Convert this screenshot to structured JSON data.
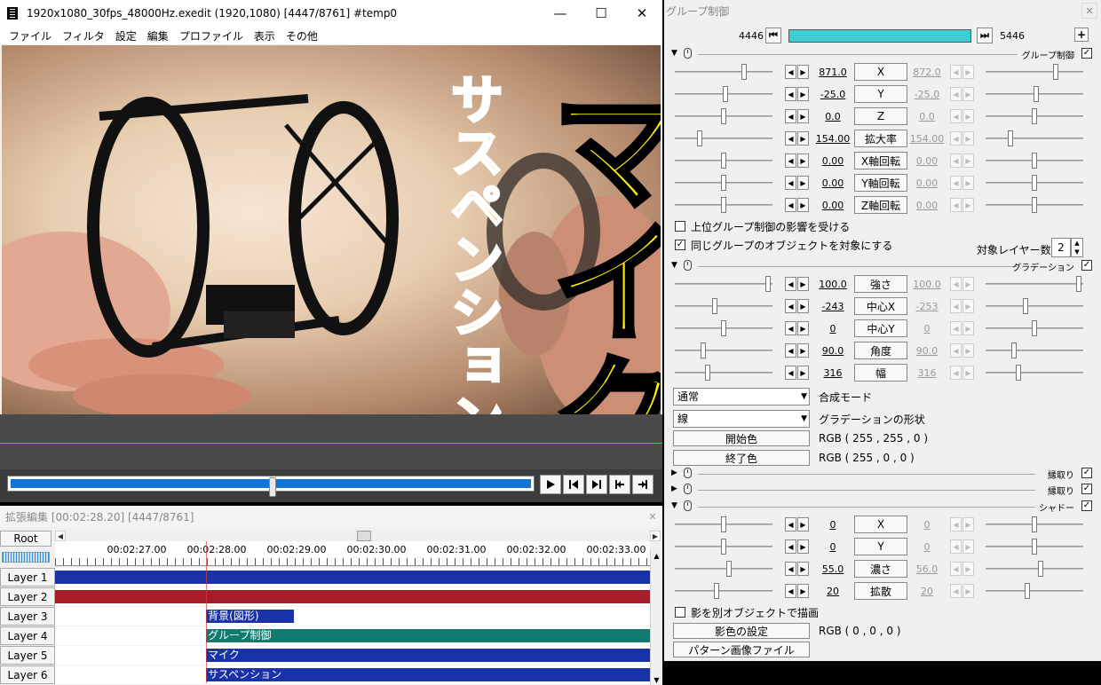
{
  "main": {
    "title": "1920x1080_30fps_48000Hz.exedit (1920,1080)  [4447/8761]  #temp0",
    "window_buttons": [
      "—",
      "☐",
      "✕"
    ],
    "menu": [
      "ファイル",
      "フィルタ",
      "設定",
      "編集",
      "プロファイル",
      "表示",
      "その他"
    ],
    "preview": {
      "text_main": "マイク",
      "text_sub": "サスペンション"
    },
    "seek_progress": 0.5
  },
  "timeline": {
    "title": "拡張編集 [00:02:28.20] [4447/8761]",
    "close": "✕",
    "root_label": "Root",
    "ticks": [
      "00:02:27.00",
      "00:02:28.00",
      "00:02:29.00",
      "00:02:30.00",
      "00:02:31.00",
      "00:02:32.00",
      "00:02:33.00"
    ],
    "layers": [
      {
        "name": "Layer 1",
        "clip_label": "",
        "color": "#1932a8",
        "start": 0.0
      },
      {
        "name": "Layer 2",
        "clip_label": "",
        "color": "#a61c28",
        "start": 0.0
      },
      {
        "name": "Layer 3",
        "clip_label": "背景(図形)",
        "color": "#1932a8",
        "start": 0.254,
        "end": 0.402
      },
      {
        "name": "Layer 4",
        "clip_label": "グループ制御",
        "color": "#0f7a6e",
        "start": 0.254
      },
      {
        "name": "Layer 5",
        "clip_label": "マイク",
        "color": "#1932a8",
        "start": 0.254
      },
      {
        "name": "Layer 6",
        "clip_label": "サスペンション",
        "color": "#1932a8",
        "start": 0.254
      }
    ]
  },
  "gc": {
    "title": "グループ制御",
    "close": "✕",
    "frame_start": "4446",
    "frame_end": "5446",
    "section1_name": "グループ制御",
    "params1": [
      {
        "label": "X",
        "start": "871.0",
        "end": "872.0",
        "pos_l": 0.72,
        "pos_r": 0.73
      },
      {
        "label": "Y",
        "start": "-25.0",
        "end": "-25.0",
        "pos_l": 0.52,
        "pos_r": 0.52
      },
      {
        "label": "Z",
        "start": "0.0",
        "end": "0.0",
        "pos_l": 0.5,
        "pos_r": 0.5
      },
      {
        "label": "拡大率",
        "start": "154.00",
        "end": "154.00",
        "pos_l": 0.24,
        "pos_r": 0.24
      },
      {
        "label": "X軸回転",
        "start": "0.00",
        "end": "0.00",
        "pos_l": 0.5,
        "pos_r": 0.5
      },
      {
        "label": "Y軸回転",
        "start": "0.00",
        "end": "0.00",
        "pos_l": 0.5,
        "pos_r": 0.5
      },
      {
        "label": "Z軸回転",
        "start": "0.00",
        "end": "0.00",
        "pos_l": 0.5,
        "pos_r": 0.5
      }
    ],
    "cb_upper": "上位グループ制御の影響を受ける",
    "cb_same": "同じグループのオブジェクトを対象にする",
    "layer_count_label": "対象レイヤー数",
    "layer_count": "2",
    "section2_name": "グラデーション",
    "params2": [
      {
        "label": "強さ",
        "start": "100.0",
        "end": "100.0",
        "pos_l": 0.98,
        "pos_r": 0.98
      },
      {
        "label": "中心X",
        "start": "-243",
        "end": "-253",
        "pos_l": 0.4,
        "pos_r": 0.4
      },
      {
        "label": "中心Y",
        "start": "0",
        "end": "0",
        "pos_l": 0.5,
        "pos_r": 0.5
      },
      {
        "label": "角度",
        "start": "90.0",
        "end": "90.0",
        "pos_l": 0.28,
        "pos_r": 0.28
      },
      {
        "label": "幅",
        "start": "316",
        "end": "316",
        "pos_l": 0.33,
        "pos_r": 0.33
      }
    ],
    "blend_mode": "通常",
    "blend_mode_label": "合成モード",
    "grad_shape": "線",
    "grad_shape_label": "グラデーションの形状",
    "start_color_btn": "開始色",
    "start_color": "RGB ( 255 , 255 , 0 )",
    "end_color_btn": "終了色",
    "end_color": "RGB ( 255 , 0 , 0 )",
    "section3_name": "縁取り",
    "section4_name": "縁取り",
    "section5_name": "シャドー",
    "params5": [
      {
        "label": "X",
        "start": "0",
        "end": "0",
        "pos_l": 0.5,
        "pos_r": 0.5
      },
      {
        "label": "Y",
        "start": "0",
        "end": "0",
        "pos_l": 0.5,
        "pos_r": 0.5
      },
      {
        "label": "濃さ",
        "start": "55.0",
        "end": "56.0",
        "pos_l": 0.56,
        "pos_r": 0.57
      },
      {
        "label": "拡散",
        "start": "20",
        "end": "20",
        "pos_l": 0.42,
        "pos_r": 0.42
      }
    ],
    "cb_shadow_separate": "影を別オブジェクトで描画",
    "shadow_color_btn": "影色の設定",
    "shadow_color": "RGB ( 0 , 0 , 0 )",
    "pattern_btn": "パターン画像ファイル"
  }
}
